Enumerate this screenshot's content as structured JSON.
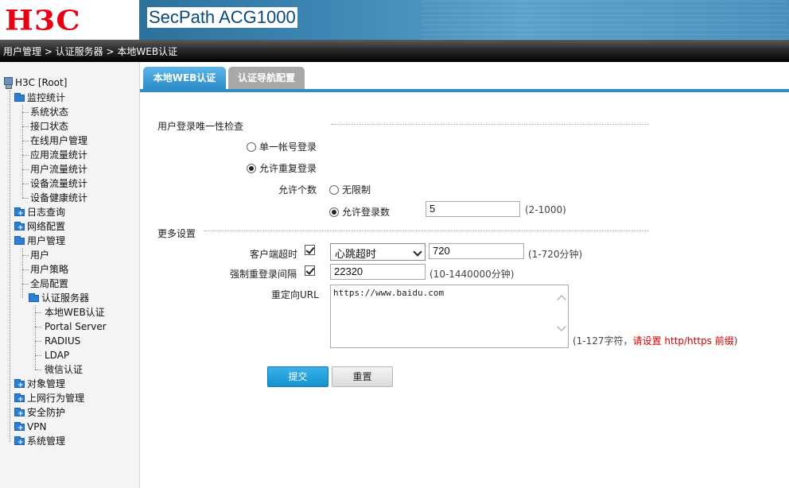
{
  "header": {
    "logo": "H3C",
    "product": "SecPath ACG1000"
  },
  "breadcrumb": "用户管理 > 认证服务器 > 本地WEB认证",
  "sidebar": {
    "root": "H3C [Root]",
    "items": [
      {
        "label": "监控统计",
        "children": [
          "系统状态",
          "接口状态",
          "在线用户管理",
          "应用流量统计",
          "用户流量统计",
          "设备流量统计",
          "设备健康统计"
        ]
      },
      {
        "label": "日志查询"
      },
      {
        "label": "网络配置"
      },
      {
        "label": "用户管理",
        "children": [
          "用户",
          "用户策略",
          "全局配置"
        ]
      },
      {
        "label": "认证服务器",
        "children": [
          "本地WEB认证",
          "Portal Server",
          "RADIUS",
          "LDAP",
          "微信认证"
        ]
      },
      {
        "label": "对象管理"
      },
      {
        "label": "上网行为管理"
      },
      {
        "label": "安全防护"
      },
      {
        "label": "VPN"
      },
      {
        "label": "系统管理"
      }
    ]
  },
  "tabs": [
    {
      "label": "本地WEB认证",
      "active": true
    },
    {
      "label": "认证导航配置",
      "active": false
    }
  ],
  "form": {
    "login_check_title": "用户登录唯一性检查",
    "radio_single": "单一帐号登录",
    "radio_allow_repeat": "允许重复登录",
    "allow_count_label": "允许个数",
    "radio_unlimited": "无限制",
    "radio_limit": "允许登录数",
    "limit_value": "5",
    "limit_hint": "(2-1000)",
    "more_settings_title": "更多设置",
    "client_timeout_label": "客户端超时",
    "client_timeout_select": "心跳超时",
    "client_timeout_value": "720",
    "client_timeout_hint": "(1-720分钟)",
    "force_relogin_label": "强制重登录间隔",
    "force_relogin_value": "22320",
    "force_relogin_hint": "(10-1440000分钟)",
    "redirect_label": "重定向URL",
    "redirect_value": "https://www.baidu.com",
    "redirect_hint_prefix": "(1-127字符，",
    "redirect_hint_red": "请设置 http/https 前缀",
    "redirect_hint_suffix": ")",
    "submit": "提交",
    "reset": "重置"
  },
  "colors": {
    "accent": "#2b8cc8",
    "logo_red": "#e60012",
    "hint_red": "#d00000"
  }
}
